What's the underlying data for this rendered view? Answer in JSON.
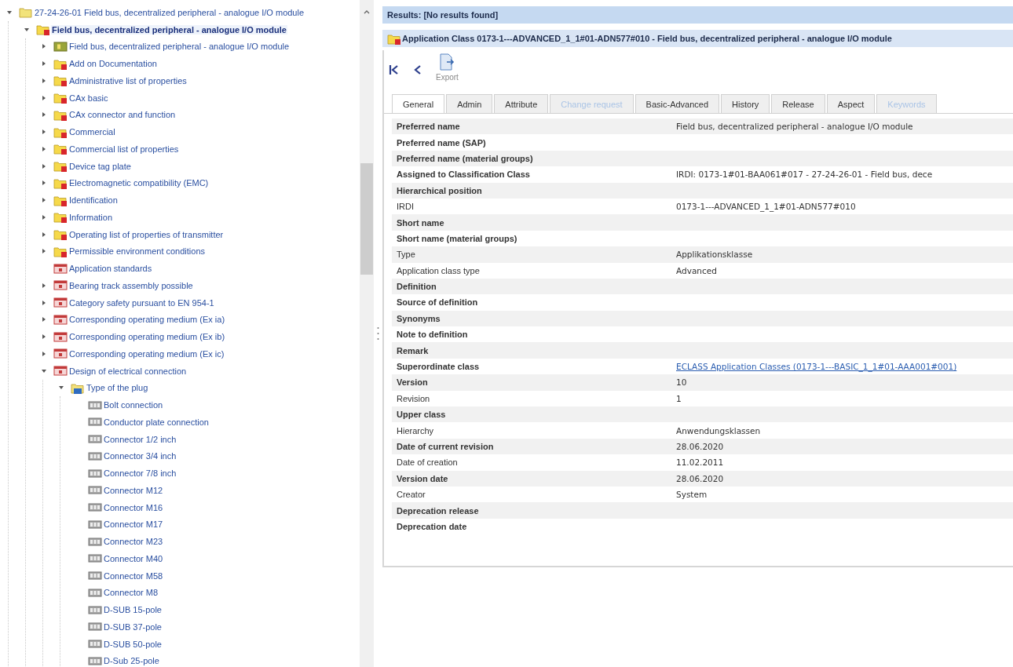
{
  "tree": [
    {
      "label": "27-24-26-01 Field bus, decentralized peripheral - analogue I/O module",
      "kind": "folder",
      "selected": false,
      "expanded": true,
      "children": [
        {
          "label": "Field bus, decentralized peripheral - analogue I/O module",
          "kind": "class-folder",
          "selected": true,
          "expanded": true,
          "children": [
            {
              "label": "Field bus, decentralized peripheral - analogue I/O module",
              "kind": "class",
              "selected": false,
              "expanded": false
            },
            {
              "label": "Add on Documentation",
              "kind": "class-folder",
              "selected": false,
              "expanded": false
            },
            {
              "label": "Administrative list of properties",
              "kind": "class-folder",
              "selected": false,
              "expanded": false
            },
            {
              "label": "CAx basic",
              "kind": "class-folder",
              "selected": false,
              "expanded": false
            },
            {
              "label": "CAx connector and function",
              "kind": "class-folder",
              "selected": false,
              "expanded": false
            },
            {
              "label": "Commercial",
              "kind": "class-folder",
              "selected": false,
              "expanded": false
            },
            {
              "label": "Commercial list of properties",
              "kind": "class-folder",
              "selected": false,
              "expanded": false
            },
            {
              "label": "Device tag plate",
              "kind": "class-folder",
              "selected": false,
              "expanded": false
            },
            {
              "label": "Electromagnetic compatibility (EMC)",
              "kind": "class-folder",
              "selected": false,
              "expanded": false
            },
            {
              "label": "Identification",
              "kind": "class-folder",
              "selected": false,
              "expanded": false
            },
            {
              "label": "Information",
              "kind": "class-folder",
              "selected": false,
              "expanded": false
            },
            {
              "label": "Operating list of properties of transmitter",
              "kind": "class-folder",
              "selected": false,
              "expanded": false
            },
            {
              "label": "Permissible environment conditions",
              "kind": "class-folder",
              "selected": false,
              "expanded": false
            },
            {
              "label": "Application standards",
              "kind": "property",
              "selected": false
            },
            {
              "label": "Bearing track assembly possible",
              "kind": "property",
              "selected": false,
              "expanded": false
            },
            {
              "label": "Category safety pursuant to EN 954-1",
              "kind": "property",
              "selected": false,
              "expanded": false
            },
            {
              "label": "Corresponding operating medium (Ex ia)",
              "kind": "property",
              "selected": false,
              "expanded": false
            },
            {
              "label": "Corresponding operating medium (Ex ib)",
              "kind": "property",
              "selected": false,
              "expanded": false
            },
            {
              "label": "Corresponding operating medium (Ex ic)",
              "kind": "property",
              "selected": false,
              "expanded": false
            },
            {
              "label": "Design of electrical connection",
              "kind": "property",
              "selected": false,
              "expanded": true,
              "children": [
                {
                  "label": "Type of the plug",
                  "kind": "value-folder",
                  "selected": false,
                  "expanded": true,
                  "children": [
                    {
                      "label": "Bolt connection",
                      "kind": "value",
                      "selected": false
                    },
                    {
                      "label": "Conductor plate connection",
                      "kind": "value",
                      "selected": false
                    },
                    {
                      "label": "Connector 1/2 inch",
                      "kind": "value",
                      "selected": false
                    },
                    {
                      "label": "Connector 3/4 inch",
                      "kind": "value",
                      "selected": false
                    },
                    {
                      "label": "Connector 7/8 inch",
                      "kind": "value",
                      "selected": false
                    },
                    {
                      "label": "Connector M12",
                      "kind": "value",
                      "selected": false
                    },
                    {
                      "label": "Connector M16",
                      "kind": "value",
                      "selected": false
                    },
                    {
                      "label": "Connector M17",
                      "kind": "value",
                      "selected": false
                    },
                    {
                      "label": "Connector M23",
                      "kind": "value",
                      "selected": false
                    },
                    {
                      "label": "Connector M40",
                      "kind": "value",
                      "selected": false
                    },
                    {
                      "label": "Connector M58",
                      "kind": "value",
                      "selected": false
                    },
                    {
                      "label": "Connector M8",
                      "kind": "value",
                      "selected": false
                    },
                    {
                      "label": "D-SUB 15-pole",
                      "kind": "value",
                      "selected": false
                    },
                    {
                      "label": "D-SUB 37-pole",
                      "kind": "value",
                      "selected": false
                    },
                    {
                      "label": "D-SUB 50-pole",
                      "kind": "value",
                      "selected": false
                    },
                    {
                      "label": "D-Sub 25-pole",
                      "kind": "value",
                      "selected": false
                    }
                  ]
                }
              ]
            }
          ]
        }
      ]
    }
  ],
  "results": {
    "header": "Results: [No results found]",
    "title": "Application Class 0173-1---ADVANCED_1_1#01-ADN577#010 - Field bus, decentralized peripheral - analogue I/O module"
  },
  "toolbar": {
    "export_label": "Export"
  },
  "tabs": [
    {
      "label": "General",
      "selected": true,
      "disabled": false
    },
    {
      "label": "Admin",
      "selected": false,
      "disabled": false
    },
    {
      "label": "Attribute",
      "selected": false,
      "disabled": false
    },
    {
      "label": "Change request",
      "selected": false,
      "disabled": true
    },
    {
      "label": "Basic-Advanced",
      "selected": false,
      "disabled": false
    },
    {
      "label": "History",
      "selected": false,
      "disabled": false
    },
    {
      "label": "Release",
      "selected": false,
      "disabled": false
    },
    {
      "label": "Aspect",
      "selected": false,
      "disabled": false
    },
    {
      "label": "Keywords",
      "selected": false,
      "disabled": true
    }
  ],
  "properties": [
    {
      "label": "Preferred name",
      "bold": true,
      "value": "Field bus, decentralized peripheral - analogue I/O module"
    },
    {
      "label": "Preferred name (SAP)",
      "bold": true
    },
    {
      "label": "Preferred name (material groups)",
      "bold": true
    },
    {
      "label": "Assigned to Classification Class",
      "bold": true,
      "value": "IRDI: 0173-1#01-BAA061#017 - 27-24-26-01 - Field bus, dece"
    },
    {
      "label": "Hierarchical position",
      "bold": true
    },
    {
      "label": "IRDI",
      "bold": false,
      "value": "0173-1---ADVANCED_1_1#01-ADN577#010"
    },
    {
      "label": "Short name",
      "bold": true
    },
    {
      "label": "Short name (material groups)",
      "bold": true
    },
    {
      "label": "Type",
      "bold": false,
      "value": "Applikationsklasse"
    },
    {
      "label": "Application class type",
      "bold": false,
      "value": "Advanced"
    },
    {
      "label": "Definition",
      "bold": true
    },
    {
      "label": "Source of definition",
      "bold": true
    },
    {
      "label": "Synonyms",
      "bold": true
    },
    {
      "label": "Note to definition",
      "bold": true
    },
    {
      "label": "Remark",
      "bold": true
    },
    {
      "label": "Superordinate class",
      "bold": true,
      "value": "ECLASS Application Classes (0173-1---BASIC_1_1#01-AAA001#001)",
      "link": true
    },
    {
      "label": "Version",
      "bold": true,
      "value": "10"
    },
    {
      "label": "Revision",
      "bold": false,
      "value": "1"
    },
    {
      "label": "Upper class",
      "bold": true
    },
    {
      "label": "Hierarchy",
      "bold": false,
      "value": "Anwendungsklassen"
    },
    {
      "label": "Date of current revision",
      "bold": true,
      "value": "28.06.2020"
    },
    {
      "label": "Date of creation",
      "bold": false,
      "value": "11.02.2011"
    },
    {
      "label": "Version date",
      "bold": true,
      "value": "28.06.2020"
    },
    {
      "label": "Creator",
      "bold": false,
      "value": "System"
    },
    {
      "label": "Deprecation release",
      "bold": true
    },
    {
      "label": "Deprecation date",
      "bold": true
    }
  ]
}
